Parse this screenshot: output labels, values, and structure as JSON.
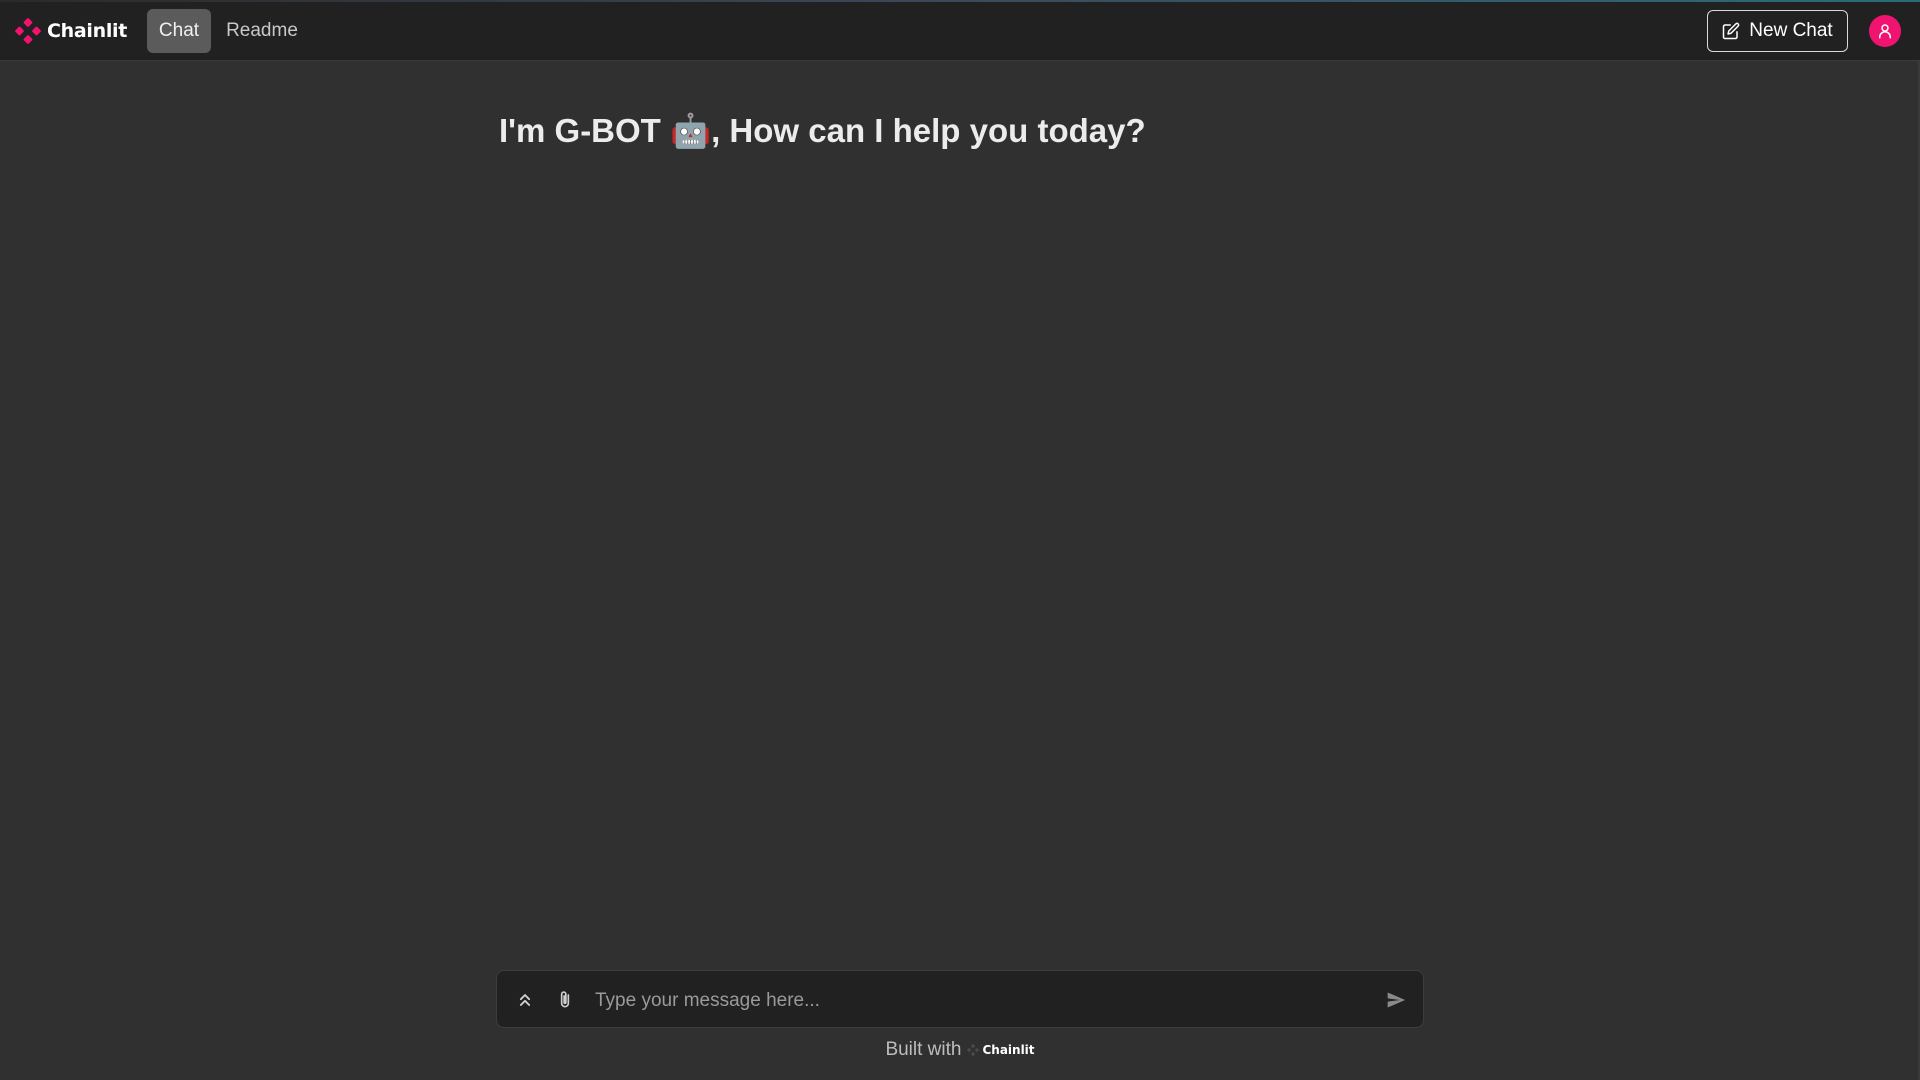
{
  "header": {
    "brand": "Chainlit",
    "tabs": [
      {
        "label": "Chat",
        "active": true
      },
      {
        "label": "Readme",
        "active": false
      }
    ],
    "new_chat_label": "New Chat"
  },
  "main": {
    "welcome": "I'm G-BOT 🤖, How can I help you today?"
  },
  "composer": {
    "placeholder": "Type your message here...",
    "value": ""
  },
  "footer": {
    "built_with": "Built with",
    "brand": "Chainlit"
  },
  "colors": {
    "accent": "#f0136f",
    "background": "#303030",
    "header": "#212121"
  },
  "icons": {
    "brand": "chainlit-logo-icon",
    "new_chat": "edit-icon",
    "avatar": "user-icon",
    "settings": "chevrons-up-icon",
    "attach": "paperclip-icon",
    "send": "send-icon"
  }
}
